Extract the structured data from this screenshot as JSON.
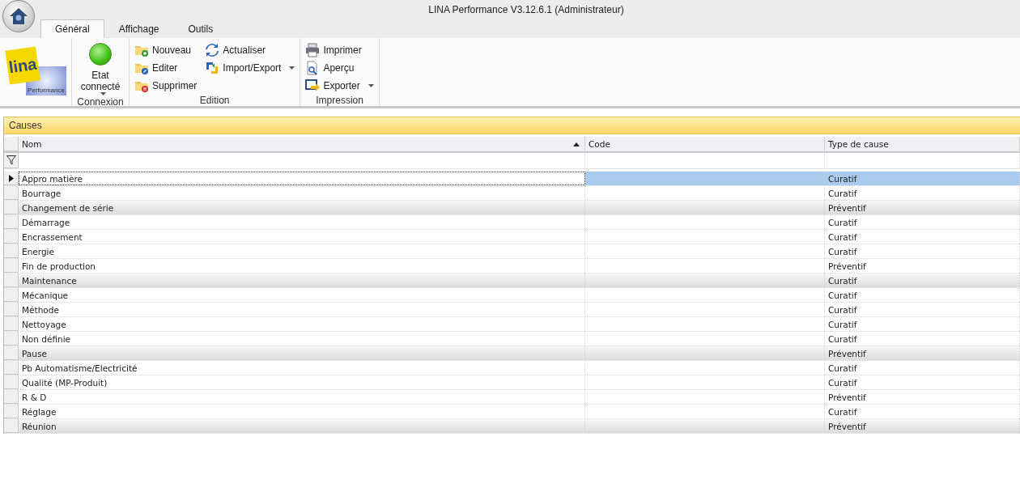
{
  "window": {
    "title": "LINA Performance  V3.12.6.1  (Administrateur)"
  },
  "tabs": [
    {
      "label": "Général",
      "selected": true
    },
    {
      "label": "Affichage",
      "selected": false
    },
    {
      "label": "Outils",
      "selected": false
    }
  ],
  "ribbon": {
    "logo": {
      "caption": "Performance",
      "wordmark": "lina"
    },
    "connexion": {
      "label": "Etat connecté",
      "connected": true,
      "group": "Connexion"
    },
    "edition": {
      "group": "Edition",
      "items": [
        {
          "label": "Nouveau",
          "dropdown": false
        },
        {
          "label": "Editer",
          "dropdown": false
        },
        {
          "label": "Supprimer",
          "dropdown": false
        },
        {
          "label": "Actualiser",
          "dropdown": false
        },
        {
          "label": "Import/Export",
          "dropdown": true
        }
      ]
    },
    "impression": {
      "group": "Impression",
      "items": [
        {
          "label": "Imprimer",
          "dropdown": false
        },
        {
          "label": "Aperçu",
          "dropdown": false
        },
        {
          "label": "Exporter",
          "dropdown": true
        }
      ]
    }
  },
  "table": {
    "title": "Causes",
    "columns": [
      {
        "label": "Nom",
        "sorted": true
      },
      {
        "label": "Code",
        "sorted": false
      },
      {
        "label": "Type de cause",
        "sorted": false
      }
    ],
    "rows": [
      {
        "name": "Appro matière",
        "type": "Curatif",
        "selected": true,
        "shaded": false
      },
      {
        "name": "Bourrage",
        "type": "Curatif",
        "selected": false,
        "shaded": false
      },
      {
        "name": "Changement de série",
        "type": "Préventif",
        "selected": false,
        "shaded": true
      },
      {
        "name": "Démarrage",
        "type": "Curatif",
        "selected": false,
        "shaded": false
      },
      {
        "name": "Encrassement",
        "type": "Curatif",
        "selected": false,
        "shaded": false
      },
      {
        "name": "Energie",
        "type": "Curatif",
        "selected": false,
        "shaded": false
      },
      {
        "name": "Fin de production",
        "type": "Préventif",
        "selected": false,
        "shaded": false
      },
      {
        "name": "Maintenance",
        "type": "Curatif",
        "selected": false,
        "shaded": true
      },
      {
        "name": "Mécanique",
        "type": "Curatif",
        "selected": false,
        "shaded": false
      },
      {
        "name": "Méthode",
        "type": "Curatif",
        "selected": false,
        "shaded": false
      },
      {
        "name": "Nettoyage",
        "type": "Curatif",
        "selected": false,
        "shaded": false
      },
      {
        "name": "Non définie",
        "type": "Curatif",
        "selected": false,
        "shaded": false
      },
      {
        "name": "Pause",
        "type": "Préventif",
        "selected": false,
        "shaded": true
      },
      {
        "name": "Pb Automatisme/Electricité",
        "type": "Curatif",
        "selected": false,
        "shaded": false
      },
      {
        "name": "Qualité (MP-Produit)",
        "type": "Curatif",
        "selected": false,
        "shaded": false
      },
      {
        "name": "R & D",
        "type": "Préventif",
        "selected": false,
        "shaded": false
      },
      {
        "name": "Réglage",
        "type": "Curatif",
        "selected": false,
        "shaded": false
      },
      {
        "name": "Réunion",
        "type": "Préventif",
        "selected": false,
        "shaded": true
      }
    ]
  }
}
